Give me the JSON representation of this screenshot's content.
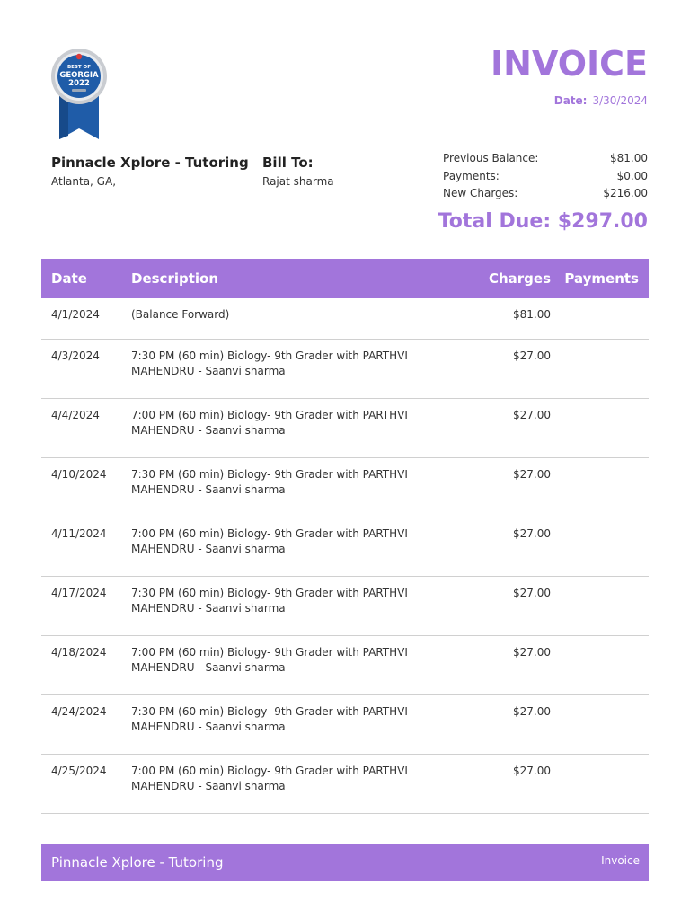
{
  "badge": {
    "line1": "BEST OF",
    "line2": "GEORGIA",
    "line3": "2022",
    "colors": {
      "blue": "#1f5ca8",
      "silver": "#c9ccd1",
      "red": "#d93a3a"
    }
  },
  "invoice": {
    "title": "INVOICE",
    "date_label": "Date:",
    "date_value": "3/30/2024",
    "accent_color": "#a275db"
  },
  "from": {
    "name": "Pinnacle Xplore - Tutoring",
    "address": "Atlanta, GA,"
  },
  "bill_to": {
    "label": "Bill To:",
    "name": "Rajat sharma"
  },
  "summary": [
    {
      "label": "Previous Balance:",
      "value": "$81.00"
    },
    {
      "label": "Payments:",
      "value": "$0.00"
    },
    {
      "label": "New Charges:",
      "value": "$216.00"
    }
  ],
  "total_due": "Total Due: $297.00",
  "table": {
    "headers": {
      "date": "Date",
      "description": "Description",
      "charges": "Charges",
      "payments": "Payments"
    },
    "rows": [
      {
        "date": "4/1/2024",
        "description": "(Balance Forward)",
        "charges": "$81.00",
        "payments": ""
      },
      {
        "date": "4/3/2024",
        "description": "7:30 PM (60 min) Biology- 9th Grader with PARTHVI MAHENDRU - Saanvi sharma",
        "charges": "$27.00",
        "payments": ""
      },
      {
        "date": "4/4/2024",
        "description": "7:00 PM (60 min) Biology- 9th Grader with PARTHVI MAHENDRU - Saanvi sharma",
        "charges": "$27.00",
        "payments": ""
      },
      {
        "date": "4/10/2024",
        "description": "7:30 PM (60 min) Biology- 9th Grader with PARTHVI MAHENDRU - Saanvi sharma",
        "charges": "$27.00",
        "payments": ""
      },
      {
        "date": "4/11/2024",
        "description": "7:00 PM (60 min) Biology- 9th Grader with PARTHVI MAHENDRU - Saanvi sharma",
        "charges": "$27.00",
        "payments": ""
      },
      {
        "date": "4/17/2024",
        "description": "7:30 PM (60 min) Biology- 9th Grader with PARTHVI MAHENDRU - Saanvi sharma",
        "charges": "$27.00",
        "payments": ""
      },
      {
        "date": "4/18/2024",
        "description": "7:00 PM (60 min) Biology- 9th Grader with PARTHVI MAHENDRU - Saanvi sharma",
        "charges": "$27.00",
        "payments": ""
      },
      {
        "date": "4/24/2024",
        "description": "7:30 PM (60 min) Biology- 9th Grader with PARTHVI MAHENDRU - Saanvi sharma",
        "charges": "$27.00",
        "payments": ""
      },
      {
        "date": "4/25/2024",
        "description": "7:00 PM (60 min) Biology- 9th Grader with PARTHVI MAHENDRU - Saanvi sharma",
        "charges": "$27.00",
        "payments": ""
      }
    ]
  },
  "footer": {
    "name": "Pinnacle Xplore - Tutoring",
    "right_label": "Invoice"
  }
}
